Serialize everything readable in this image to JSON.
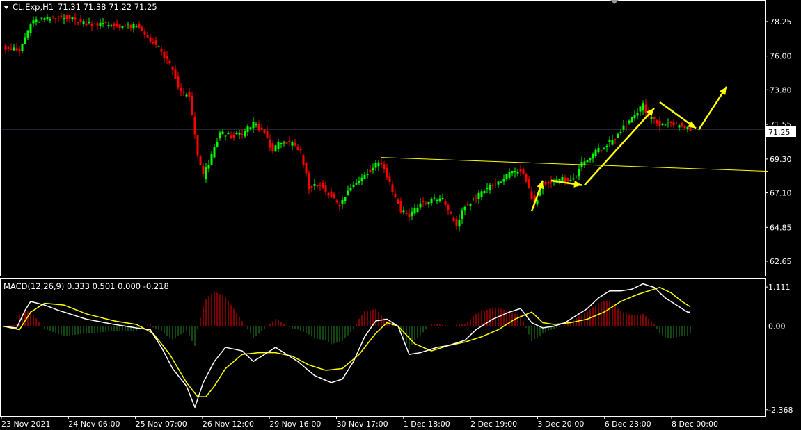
{
  "price_header": {
    "symbol": "CL.Exp,H1",
    "ohlc": "71.31 71.38 71.22 71.25"
  },
  "macd_header": {
    "label": "MACD(12,26,9) 0.333 0.501 0.000 -0.218"
  },
  "current_price_label": "71.25",
  "colors": {
    "background": "#000000",
    "bull_candle": "#00ff00",
    "bear_candle": "#ff0000",
    "annotation": "#ffff00",
    "macd_line": "#ffffff",
    "signal_line": "#ffff00",
    "hist_positive": "#ff0000",
    "hist_negative": "#228b22",
    "price_line": "#8899bb",
    "axis": "#ffffff"
  },
  "chart_data": {
    "type": "candlestick",
    "symbol": "CL.Exp",
    "timeframe": "H1",
    "price_axis": {
      "ticks": [
        "78.25",
        "76.00",
        "73.80",
        "71.55",
        "69.30",
        "67.10",
        "64.85",
        "62.65"
      ],
      "range": [
        61.7,
        79.6
      ]
    },
    "macd_axis": {
      "ticks": [
        "1.111",
        "0.00",
        "-2.368"
      ],
      "range": [
        -2.55,
        1.35
      ]
    },
    "time_axis": {
      "labels": [
        "23 Nov 2021",
        "24 Nov 06:00",
        "25 Nov 07:00",
        "26 Nov 12:00",
        "29 Nov 16:00",
        "30 Nov 17:00",
        "1 Dec 18:00",
        "2 Dec 19:00",
        "3 Dec 20:00",
        "6 Dec 23:00",
        "8 Dec 00:00"
      ]
    },
    "close_path": [
      [
        0,
        76.6
      ],
      [
        6,
        76.3
      ],
      [
        10,
        78.1
      ],
      [
        14,
        78.4
      ],
      [
        18,
        78.4
      ],
      [
        22,
        78.6
      ],
      [
        28,
        78.2
      ],
      [
        34,
        78.1
      ],
      [
        40,
        78.0
      ],
      [
        48,
        77.9
      ],
      [
        50,
        77.6
      ],
      [
        56,
        76.5
      ],
      [
        60,
        75.4
      ],
      [
        64,
        73.6
      ],
      [
        67,
        73.4
      ],
      [
        70,
        69.5
      ],
      [
        72,
        68.2
      ],
      [
        74,
        69.0
      ],
      [
        78,
        71.0
      ],
      [
        82,
        70.8
      ],
      [
        86,
        70.9
      ],
      [
        90,
        71.6
      ],
      [
        94,
        71.0
      ],
      [
        97,
        69.8
      ],
      [
        100,
        70.5
      ],
      [
        104,
        70.2
      ],
      [
        107,
        69.7
      ],
      [
        110,
        67.5
      ],
      [
        114,
        67.6
      ],
      [
        118,
        66.9
      ],
      [
        121,
        66.2
      ],
      [
        124,
        67.2
      ],
      [
        128,
        68.0
      ],
      [
        132,
        68.6
      ],
      [
        135,
        69.2
      ],
      [
        137,
        68.7
      ],
      [
        140,
        67.2
      ],
      [
        143,
        66.0
      ],
      [
        146,
        65.6
      ],
      [
        150,
        66.4
      ],
      [
        154,
        66.6
      ],
      [
        158,
        66.7
      ],
      [
        160,
        65.9
      ],
      [
        163,
        65.0
      ],
      [
        166,
        66.2
      ],
      [
        170,
        66.8
      ],
      [
        174,
        67.4
      ],
      [
        178,
        67.8
      ],
      [
        182,
        68.3
      ],
      [
        186,
        68.6
      ],
      [
        188,
        67.9
      ],
      [
        191,
        66.3
      ],
      [
        194,
        67.7
      ],
      [
        198,
        67.8
      ],
      [
        202,
        68.0
      ],
      [
        206,
        68.1
      ],
      [
        208,
        69.1
      ],
      [
        212,
        69.6
      ],
      [
        216,
        70.1
      ],
      [
        220,
        70.6
      ],
      [
        224,
        71.6
      ],
      [
        228,
        72.3
      ],
      [
        230,
        72.8
      ],
      [
        232,
        72.0
      ],
      [
        236,
        71.6
      ],
      [
        240,
        71.55
      ],
      [
        244,
        71.45
      ],
      [
        247,
        71.25
      ]
    ],
    "macd": [
      [
        0,
        0.0
      ],
      [
        5,
        -0.05
      ],
      [
        8,
        0.45
      ],
      [
        10,
        0.7
      ],
      [
        15,
        0.6
      ],
      [
        20,
        0.45
      ],
      [
        30,
        0.2
      ],
      [
        40,
        0.05
      ],
      [
        48,
        -0.05
      ],
      [
        53,
        -0.1
      ],
      [
        57,
        -0.6
      ],
      [
        61,
        -1.2
      ],
      [
        66,
        -1.7
      ],
      [
        69,
        -2.3
      ],
      [
        72,
        -1.6
      ],
      [
        76,
        -1.0
      ],
      [
        80,
        -0.6
      ],
      [
        86,
        -0.7
      ],
      [
        90,
        -1.0
      ],
      [
        94,
        -0.8
      ],
      [
        98,
        -0.6
      ],
      [
        102,
        -0.8
      ],
      [
        106,
        -1.0
      ],
      [
        112,
        -1.4
      ],
      [
        118,
        -1.6
      ],
      [
        122,
        -1.5
      ],
      [
        126,
        -1.0
      ],
      [
        130,
        -0.3
      ],
      [
        134,
        0.15
      ],
      [
        138,
        0.2
      ],
      [
        142,
        0.0
      ],
      [
        146,
        -0.8
      ],
      [
        150,
        -0.75
      ],
      [
        156,
        -0.6
      ],
      [
        160,
        -0.55
      ],
      [
        166,
        -0.4
      ],
      [
        170,
        -0.1
      ],
      [
        176,
        0.2
      ],
      [
        182,
        0.4
      ],
      [
        186,
        0.5
      ],
      [
        190,
        0.1
      ],
      [
        194,
        -0.05
      ],
      [
        198,
        0.0
      ],
      [
        202,
        0.1
      ],
      [
        206,
        0.3
      ],
      [
        210,
        0.5
      ],
      [
        214,
        0.8
      ],
      [
        218,
        1.0
      ],
      [
        222,
        1.0
      ],
      [
        226,
        1.05
      ],
      [
        230,
        1.2
      ],
      [
        234,
        1.1
      ],
      [
        238,
        0.8
      ],
      [
        242,
        0.6
      ],
      [
        246,
        0.4
      ]
    ],
    "signal": [
      [
        0,
        0.0
      ],
      [
        6,
        -0.1
      ],
      [
        10,
        0.4
      ],
      [
        15,
        0.65
      ],
      [
        22,
        0.6
      ],
      [
        30,
        0.35
      ],
      [
        40,
        0.15
      ],
      [
        48,
        0.05
      ],
      [
        54,
        -0.2
      ],
      [
        60,
        -0.8
      ],
      [
        66,
        -1.6
      ],
      [
        70,
        -2.0
      ],
      [
        73,
        -2.0
      ],
      [
        76,
        -1.7
      ],
      [
        80,
        -1.2
      ],
      [
        86,
        -0.8
      ],
      [
        92,
        -0.75
      ],
      [
        98,
        -0.75
      ],
      [
        104,
        -0.85
      ],
      [
        110,
        -1.1
      ],
      [
        116,
        -1.25
      ],
      [
        122,
        -1.2
      ],
      [
        128,
        -0.8
      ],
      [
        134,
        -0.2
      ],
      [
        138,
        0.1
      ],
      [
        142,
        0.0
      ],
      [
        148,
        -0.5
      ],
      [
        154,
        -0.7
      ],
      [
        160,
        -0.55
      ],
      [
        166,
        -0.45
      ],
      [
        172,
        -0.3
      ],
      [
        178,
        -0.1
      ],
      [
        184,
        0.2
      ],
      [
        190,
        0.4
      ],
      [
        194,
        0.1
      ],
      [
        198,
        0.05
      ],
      [
        204,
        0.1
      ],
      [
        210,
        0.2
      ],
      [
        216,
        0.4
      ],
      [
        222,
        0.7
      ],
      [
        228,
        0.9
      ],
      [
        232,
        1.0
      ],
      [
        236,
        1.1
      ],
      [
        240,
        0.95
      ],
      [
        244,
        0.7
      ],
      [
        247,
        0.55
      ]
    ],
    "annotations": {
      "horizontal_levels": [
        71.25
      ],
      "trendline": [
        [
          136,
          69.4
        ],
        [
          275,
          68.5
        ]
      ],
      "arrows": [
        {
          "from": [
            190,
            65.9
          ],
          "to": [
            194,
            67.9
          ]
        },
        {
          "from": [
            197,
            67.9
          ],
          "to": [
            208,
            67.6
          ]
        },
        {
          "from": [
            209,
            67.6
          ],
          "to": [
            234,
            72.6
          ]
        },
        {
          "from": [
            236,
            73.0
          ],
          "to": [
            249,
            71.3
          ]
        },
        {
          "from": [
            250,
            71.2
          ],
          "to": [
            260,
            74.0
          ]
        }
      ]
    }
  }
}
